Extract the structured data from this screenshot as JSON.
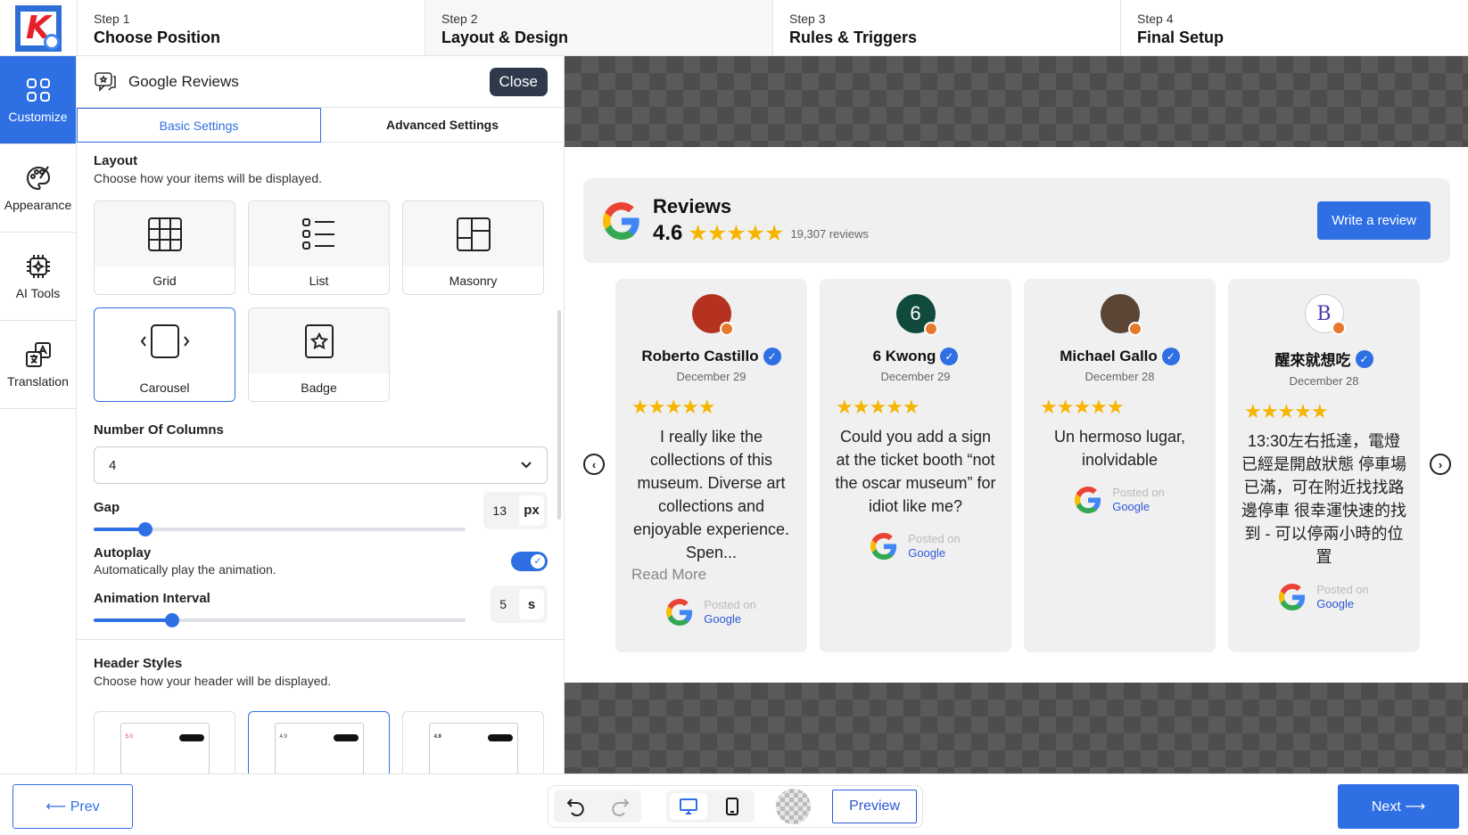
{
  "steps": [
    {
      "num": "Step 1",
      "name": "Choose Position"
    },
    {
      "num": "Step 2",
      "name": "Layout & Design"
    },
    {
      "num": "Step 3",
      "name": "Rules & Triggers"
    },
    {
      "num": "Step 4",
      "name": "Final Setup"
    }
  ],
  "nav": [
    {
      "label": "Customize",
      "icon": "customize-icon"
    },
    {
      "label": "Appearance",
      "icon": "palette-icon"
    },
    {
      "label": "AI Tools",
      "icon": "chip-icon"
    },
    {
      "label": "Translation",
      "icon": "translate-icon"
    }
  ],
  "panel": {
    "title": "Google Reviews",
    "close_label": "Close",
    "tabs": [
      "Basic Settings",
      "Advanced Settings"
    ],
    "layout_title": "Layout",
    "layout_desc": "Choose how your items will be displayed.",
    "layouts": [
      "Grid",
      "List",
      "Masonry",
      "Carousel",
      "Badge"
    ],
    "layout_selected": "Carousel",
    "columns_title": "Number Of Columns",
    "columns_value": "4",
    "gap_title": "Gap",
    "gap_value": "13",
    "gap_unit": "px",
    "gap_fraction": 0.14,
    "autoplay_title": "Autoplay",
    "autoplay_desc": "Automatically play the animation.",
    "autoplay_on": true,
    "interval_title": "Animation Interval",
    "interval_value": "5",
    "interval_unit": "s",
    "interval_fraction": 0.21,
    "header_title": "Header Styles",
    "header_desc": "Choose how your header will be displayed.",
    "header_thumb_ratings": [
      "5.0",
      "4.9",
      "4.9"
    ]
  },
  "widget": {
    "title": "Reviews",
    "rating": "4.6",
    "count": "19,307 reviews",
    "write_label": "Write a review",
    "reviews": [
      {
        "name": "Roberto Castillo",
        "date": "December 29",
        "text": "I really like the collections of this museum. Diverse art collections and enjoyable experience. Spen...",
        "more": "Read More",
        "avatar_color": "#b4321f",
        "initial": ""
      },
      {
        "name": "6 Kwong",
        "date": "December 29",
        "text": "Could you add a sign at the ticket booth “not the oscar museum” for idiot like me?",
        "more": "",
        "avatar_color": "#0f4a3c",
        "initial": "6"
      },
      {
        "name": "Michael Gallo",
        "date": "December 28",
        "text": "Un hermoso lugar, inolvidable",
        "more": "",
        "avatar_color": "#5b4636",
        "initial": ""
      },
      {
        "name": "醒來就想吃",
        "date": "December 28",
        "text": "13:30左右抵達，電燈已經是開啟狀態 停車場已滿，可在附近找找路邊停車 很幸運快速的找到 - 可以停兩小時的位置",
        "more": "",
        "avatar_color": "#ffffff",
        "initial": "B"
      }
    ],
    "posted_on": "Posted on",
    "posted_src": "Google"
  },
  "bottom": {
    "prev": "⟵ Prev",
    "next": "Next ⟶",
    "preview": "Preview"
  },
  "colors": {
    "accent": "#2e6fe4",
    "star": "#f6b500",
    "dark": "#2e3a4b"
  }
}
